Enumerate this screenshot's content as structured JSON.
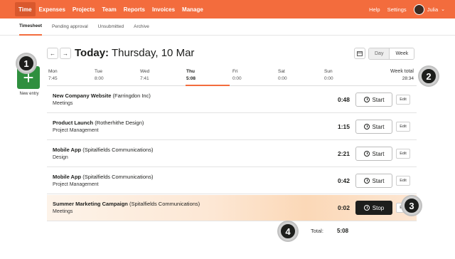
{
  "topnav": {
    "items": [
      {
        "label": "Time",
        "active": true
      },
      {
        "label": "Expenses"
      },
      {
        "label": "Projects"
      },
      {
        "label": "Team"
      },
      {
        "label": "Reports"
      },
      {
        "label": "Invoices"
      },
      {
        "label": "Manage"
      }
    ],
    "help": "Help",
    "settings": "Settings",
    "user": "Julia"
  },
  "subnav": {
    "items": [
      {
        "label": "Timesheet",
        "active": true
      },
      {
        "label": "Pending approval"
      },
      {
        "label": "Unsubmitted"
      },
      {
        "label": "Archive"
      }
    ]
  },
  "new_entry": {
    "icon": "plus-icon",
    "label": "New entry"
  },
  "header": {
    "prefix": "Today:",
    "date": "Thursday, 10 Mar"
  },
  "view_toggle": {
    "day": "Day",
    "week": "Week"
  },
  "week": {
    "days": [
      {
        "name": "Mon",
        "value": "7:45"
      },
      {
        "name": "Tue",
        "value": "8:00"
      },
      {
        "name": "Wed",
        "value": "7:41"
      },
      {
        "name": "Thu",
        "value": "5:08",
        "today": true
      },
      {
        "name": "Fri",
        "value": "0:00"
      },
      {
        "name": "Sat",
        "value": "0:00"
      },
      {
        "name": "Sun",
        "value": "0:00"
      }
    ],
    "total_label": "Week total",
    "total_value": "28:34"
  },
  "entries": [
    {
      "project": "New Company Website",
      "client": "(Farringdon Inc)",
      "task": "Meetings",
      "duration": "0:48",
      "action": "Start"
    },
    {
      "project": "Product Launch",
      "client": "(Rotherhithe Design)",
      "task": "Project Management",
      "duration": "1:15",
      "action": "Start"
    },
    {
      "project": "Mobile App",
      "client": "(Spitalfields Communications)",
      "task": "Design",
      "duration": "2:21",
      "action": "Start"
    },
    {
      "project": "Mobile App",
      "client": "(Spitalfields Communications)",
      "task": "Project Management",
      "duration": "0:42",
      "action": "Start"
    },
    {
      "project": "Summer Marketing Campaign",
      "client": "(Spitalfields Communications)",
      "task": "Meetings",
      "duration": "0:02",
      "action": "Stop"
    }
  ],
  "edit_label": "Edit",
  "total": {
    "label": "Total:",
    "value": "5:08"
  },
  "badges": [
    "1",
    "2",
    "3",
    "4"
  ],
  "colors": {
    "brand": "#f36c3d",
    "new_entry": "#2f8f3e"
  }
}
